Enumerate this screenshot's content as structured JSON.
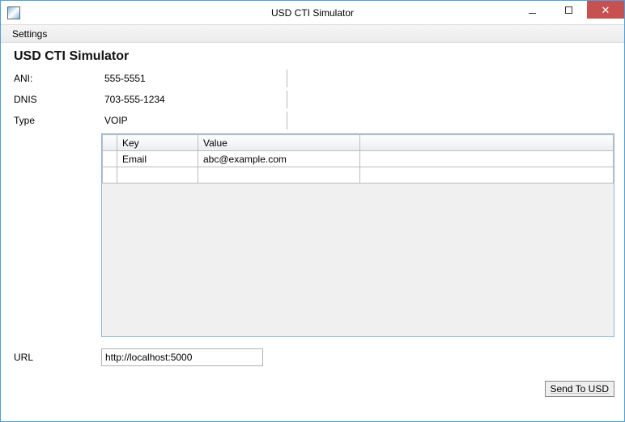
{
  "window": {
    "title": "USD CTI Simulator"
  },
  "menu": {
    "settings": "Settings"
  },
  "heading": "USD CTI Simulator",
  "form": {
    "ani_label": "ANI:",
    "ani_value": "555-5551",
    "dnis_label": "DNIS",
    "dnis_value": "703-555-1234",
    "type_label": "Type",
    "type_value": "VOIP"
  },
  "grid": {
    "columns": {
      "key": "Key",
      "value": "Value"
    },
    "rows": [
      {
        "key": "Email",
        "value": "abc@example.com"
      }
    ]
  },
  "url": {
    "label": "URL",
    "value": "http://localhost:5000"
  },
  "buttons": {
    "send": "Send To USD"
  }
}
